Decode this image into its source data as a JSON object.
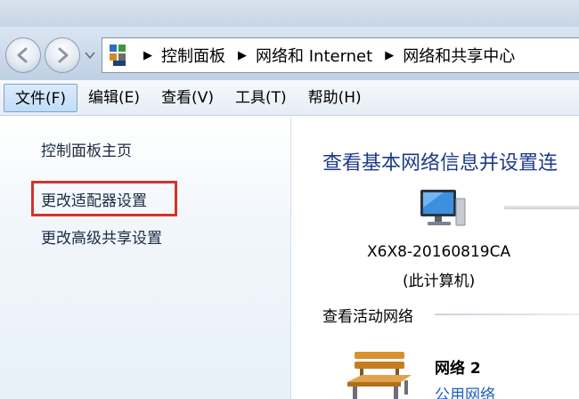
{
  "address_bar": {
    "breadcrumbs": [
      "控制面板",
      "网络和 Internet",
      "网络和共享中心"
    ]
  },
  "menu": {
    "items": [
      {
        "label": "文件(F)",
        "active": true
      },
      {
        "label": "编辑(E)"
      },
      {
        "label": "查看(V)"
      },
      {
        "label": "工具(T)"
      },
      {
        "label": "帮助(H)"
      }
    ]
  },
  "sidebar": {
    "home": "控制面板主页",
    "adapter": "更改适配器设置",
    "advanced": "更改高级共享设置"
  },
  "main": {
    "title": "查看基本网络信息并设置连",
    "computer_name": "X6X8-20160819CA",
    "computer_sub": "(此计算机)",
    "active_heading": "查看活动网络",
    "network_name": "网络  2",
    "network_type": "公用网络"
  },
  "colors": {
    "highlight": "#d7322a",
    "title": "#1e3a8a",
    "link": "#1f5fbf"
  }
}
